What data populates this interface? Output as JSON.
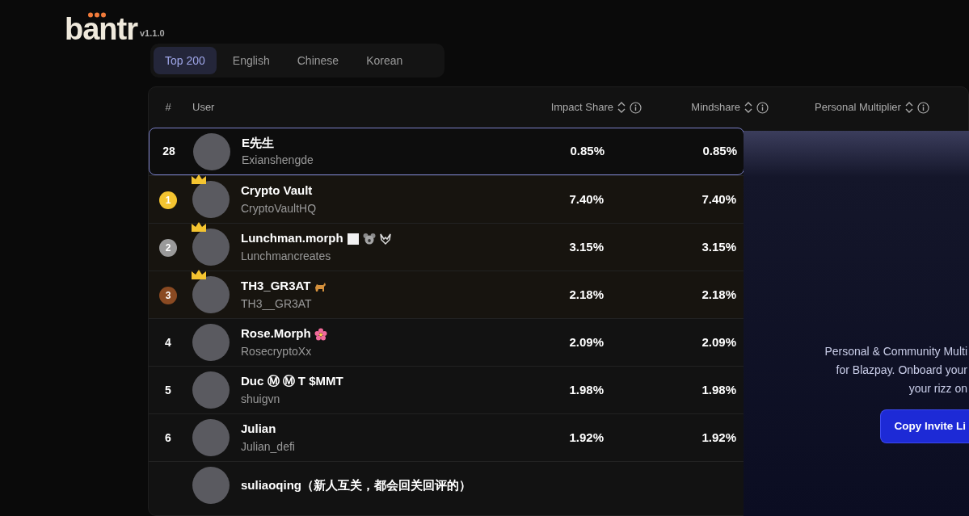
{
  "logo": {
    "text": "bantr",
    "version": "v1.1.0"
  },
  "tabs": [
    {
      "label": "Top 200",
      "selected": true
    },
    {
      "label": "English",
      "selected": false
    },
    {
      "label": "Chinese",
      "selected": false
    },
    {
      "label": "Korean",
      "selected": false
    }
  ],
  "table": {
    "columns": [
      {
        "label": "#",
        "sortable": false,
        "info": false
      },
      {
        "label": "User",
        "sortable": false,
        "info": false
      },
      {
        "label": "Impact Share",
        "sortable": true,
        "info": true
      },
      {
        "label": "Mindshare",
        "sortable": true,
        "info": true
      },
      {
        "label": "Personal Multiplier",
        "sortable": true,
        "info": true
      }
    ],
    "rows": [
      {
        "rank": "28",
        "highlighted": true,
        "crowned": false,
        "name": "E先生",
        "handle": "Exianshengde",
        "impact": "0.85%",
        "mindshare": "0.85%"
      },
      {
        "rank": "1",
        "highlighted": false,
        "crowned": true,
        "color": "#f4c430",
        "name": "Crypto Vault",
        "handle": "CryptoVaultHQ",
        "impact": "7.40%",
        "mindshare": "7.40%"
      },
      {
        "rank": "2",
        "highlighted": false,
        "crowned": true,
        "color": "#9a9a9a",
        "name": "Lunchman.morph",
        "badges": [
          {
            "kind": "square"
          },
          {
            "kind": "koala"
          },
          {
            "kind": "wings"
          }
        ],
        "handle": "Lunchmancreates",
        "impact": "3.15%",
        "mindshare": "3.15%"
      },
      {
        "rank": "3",
        "highlighted": false,
        "crowned": true,
        "color": "#8a4a22",
        "name": "TH3_GR3AT",
        "badges": [
          {
            "kind": "dog"
          }
        ],
        "handle": "TH3__GR3AT",
        "impact": "2.18%",
        "mindshare": "2.18%"
      },
      {
        "rank": "4",
        "highlighted": false,
        "crowned": false,
        "name": "Rose.Morph",
        "badges": [
          {
            "kind": "flower"
          }
        ],
        "handle": "RosecryptoXx",
        "impact": "2.09%",
        "mindshare": "2.09%"
      },
      {
        "rank": "5",
        "highlighted": false,
        "crowned": false,
        "name": "Duc Ⓜ Ⓜ T $MMT",
        "handle": "shuigvn",
        "impact": "1.98%",
        "mindshare": "1.98%"
      },
      {
        "rank": "6",
        "highlighted": false,
        "crowned": false,
        "name": "Julian",
        "handle": "Julian_defi",
        "impact": "1.92%",
        "mindshare": "1.92%"
      },
      {
        "highlighted": false,
        "crowned": false,
        "name": "suliaoqing（新人互关，都会回关回评的）"
      }
    ]
  },
  "invite_panel": {
    "lines": [
      "Personal & Community Multi",
      "for Blazpay. Onboard your",
      "your rizz on"
    ],
    "button": "Copy Invite Li"
  }
}
